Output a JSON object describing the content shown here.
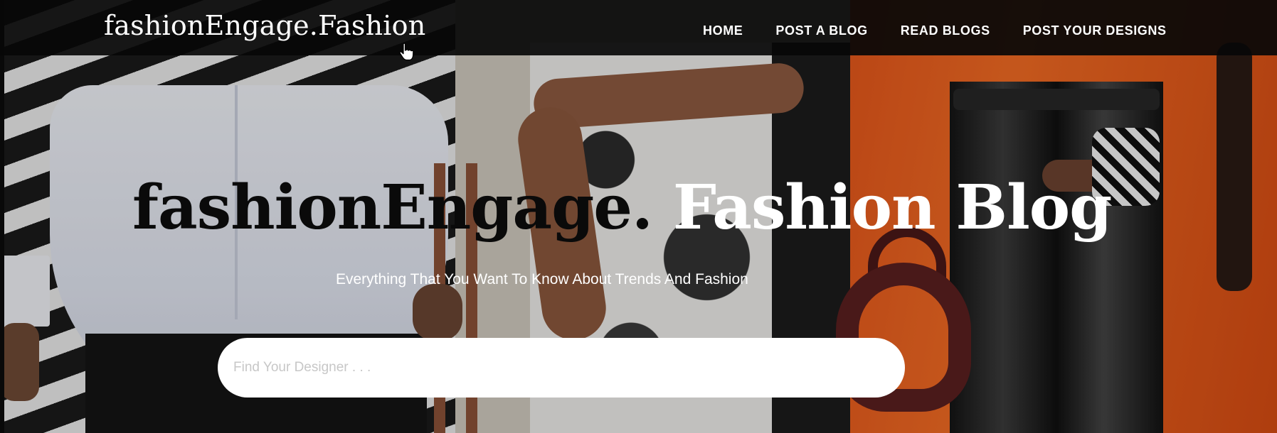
{
  "navbar": {
    "brand": "fashionEngage.Fashion",
    "links": [
      {
        "label": "HOME"
      },
      {
        "label": "POST A BLOG"
      },
      {
        "label": "READ BLOGS"
      },
      {
        "label": "POST YOUR DESIGNS"
      }
    ]
  },
  "hero": {
    "title_part1": "fashionEngage.",
    "title_part2": "Fashion Blog",
    "subtitle": "Everything That You Want To Know About Trends And Fashion",
    "background_image": "fashion-street-style-photo"
  },
  "search": {
    "placeholder": "Find Your Designer . . .",
    "value": ""
  },
  "colors": {
    "navbar_bg": "#080808",
    "nav_text": "#ffffff",
    "title_dark": "#0a0a0a",
    "title_light": "#ffffff",
    "search_bg": "#ffffff",
    "placeholder": "#c7c7c7"
  }
}
